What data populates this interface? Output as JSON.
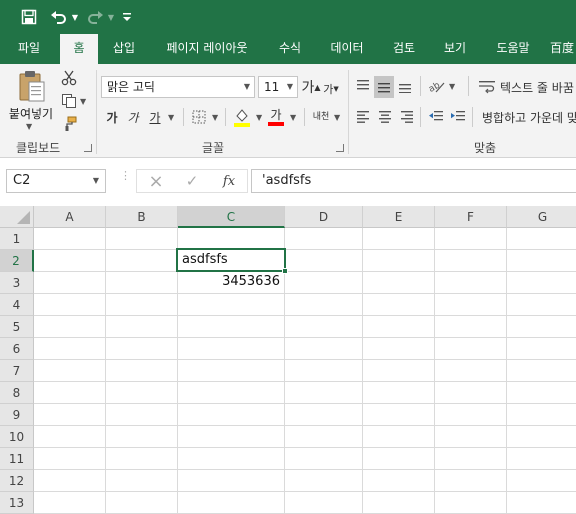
{
  "quick_access": {
    "save_icon": "save-icon",
    "undo_icon": "undo-icon",
    "redo_icon": "redo-icon",
    "customize_icon": "customize-quick-access-icon"
  },
  "tabs": [
    "파일",
    "홈",
    "삽입",
    "페이지 레이아웃",
    "수식",
    "데이터",
    "검토",
    "보기",
    "도움말",
    "百度"
  ],
  "active_tab": "홈",
  "ribbon": {
    "clipboard": {
      "paste_label": "붙여넣기",
      "group_label": "클립보드"
    },
    "font": {
      "font_name": "맑은 고딕",
      "font_size": "11",
      "grow_label": "가",
      "shrink_label": "가",
      "bold_label": "가",
      "italic_label": "가",
      "underline_label": "가",
      "font_color_label": "가",
      "phonetic_label": "내천",
      "group_label": "글꼴"
    },
    "alignment": {
      "wrap_text_label": "텍스트 줄 바꿈",
      "merge_center_label": "병합하고 가운데 맞춤",
      "group_label": "맞춤"
    }
  },
  "formula_bar": {
    "name_box": "C2",
    "cancel_icon": "×",
    "enter_icon": "✓",
    "fx_label": "fx",
    "formula": "'asdfsfs"
  },
  "sheet": {
    "columns": [
      "A",
      "B",
      "C",
      "D",
      "E",
      "F",
      "G"
    ],
    "rows": [
      "1",
      "2",
      "3",
      "4",
      "5",
      "6",
      "7",
      "8",
      "9",
      "10",
      "11",
      "12",
      "13"
    ],
    "selected_cell": "C2",
    "cells": {
      "C2": "asdfsfs",
      "C3": "3453636"
    }
  }
}
